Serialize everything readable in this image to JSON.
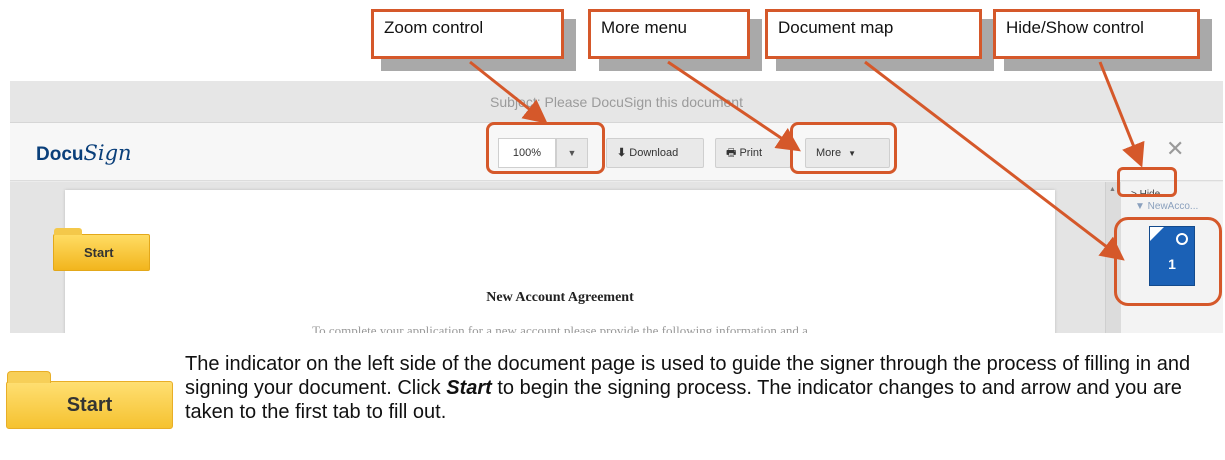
{
  "callouts": {
    "zoom_control": "Zoom control",
    "more_menu": "More menu",
    "document_map": "Document map",
    "hide_show_control": "Hide/Show control"
  },
  "subject": "Subject: Please DocuSign this document",
  "logo": {
    "prefix": "Docu",
    "script": "Sign"
  },
  "toolbar": {
    "zoom_value": "100%",
    "zoom_dropdown_icon": "chevron-down-icon",
    "download_icon": "download-arrow-icon",
    "download_label": "Download",
    "print_icon": "printer-icon",
    "print_label": "Print",
    "more_label": "More",
    "more_caret": "▼",
    "close_icon": "close-icon"
  },
  "document": {
    "start_tab": "Start",
    "title": "New Account Agreement",
    "first_line": "To complete your application for a new account please provide the following information and a"
  },
  "sidebar": {
    "hide_label": "> Hide",
    "doc_name": "▼ NewAcco...",
    "page_number": "1"
  },
  "explanation": {
    "start_button": "Start",
    "text_before": "The indicator on the left side of the document page is used to guide the signer through the process of filling in and signing your document.  Click ",
    "emphasis": "Start",
    "text_after": " to begin the signing process.  The indicator changes to and arrow and you are taken to the first tab to fill out."
  },
  "colors": {
    "callout_border": "#d5582a",
    "start_yellow": "#f5c230",
    "thumbnail_blue": "#1b61b6",
    "logo_blue": "#0a3f7a"
  }
}
